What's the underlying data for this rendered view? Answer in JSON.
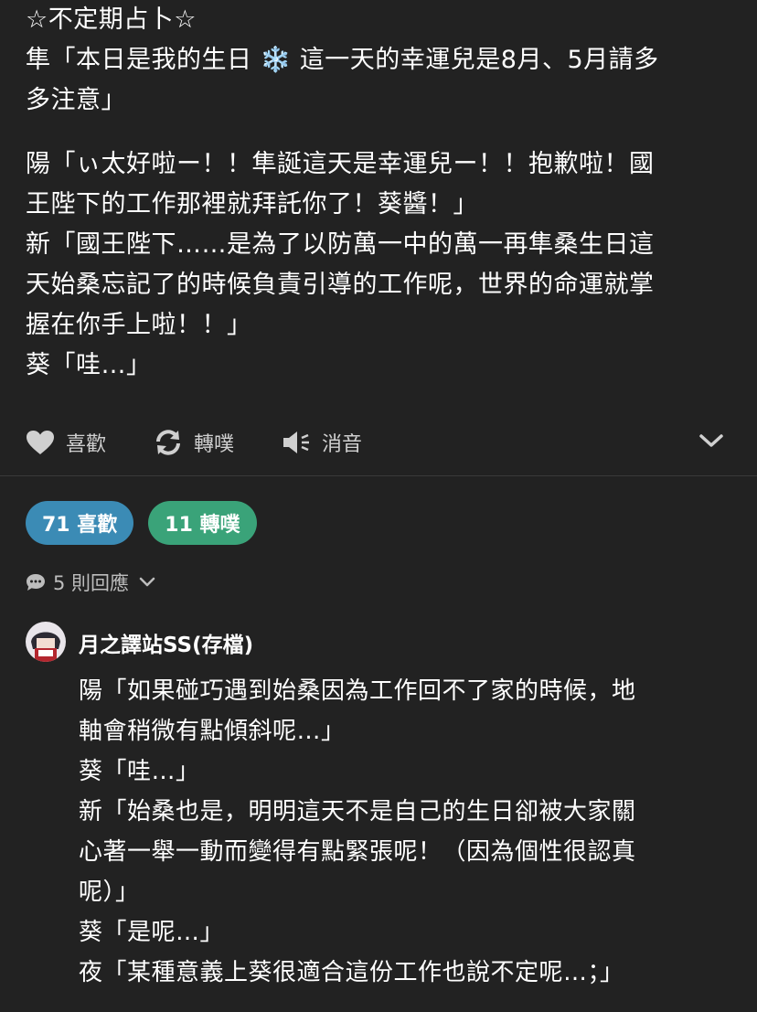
{
  "post": {
    "paragraphs": [
      [
        "☆不定期占卜☆",
        "隼「本日是我的生日 ❄️ 這一天的幸運兒是8月、5月請多",
        "多注意」"
      ],
      [
        "陽「ぃ太好啦ー！！隼誕這天是幸運兒ー！！抱歉啦！國",
        "王陛下的工作那裡就拜託你了！葵醬！」",
        "新「國王陛下……是為了以防萬一中的萬一再隼桑生日這",
        "天始桑忘記了的時候負責引導的工作呢，世界的命運就掌",
        "握在你手上啦！！」",
        "葵「哇…」"
      ]
    ]
  },
  "actions": {
    "like_label": "喜歡",
    "replurk_label": "轉噗",
    "mute_label": "消音"
  },
  "stats": {
    "likes": "71 喜歡",
    "replurks": "11 轉噗"
  },
  "responses": {
    "label": "5 則回應"
  },
  "reply": {
    "username": "月之譯站SS(存檔)",
    "lines": [
      "陽「如果碰巧遇到始桑因為工作回不了家的時候，地",
      "軸會稍微有點傾斜呢…」",
      "葵「哇…」",
      "新「始桑也是，明明這天不是自己的生日卻被大家關",
      "心著一舉一動而變得有點緊張呢！（因為個性很認真",
      "呢）」",
      "葵「是呢…」",
      "夜「某種意義上葵很適合這份工作也說不定呢…；」"
    ]
  },
  "colors": {
    "background": "#222222",
    "likes_pill": "#3b8bb5",
    "replurks_pill": "#3aa379"
  }
}
